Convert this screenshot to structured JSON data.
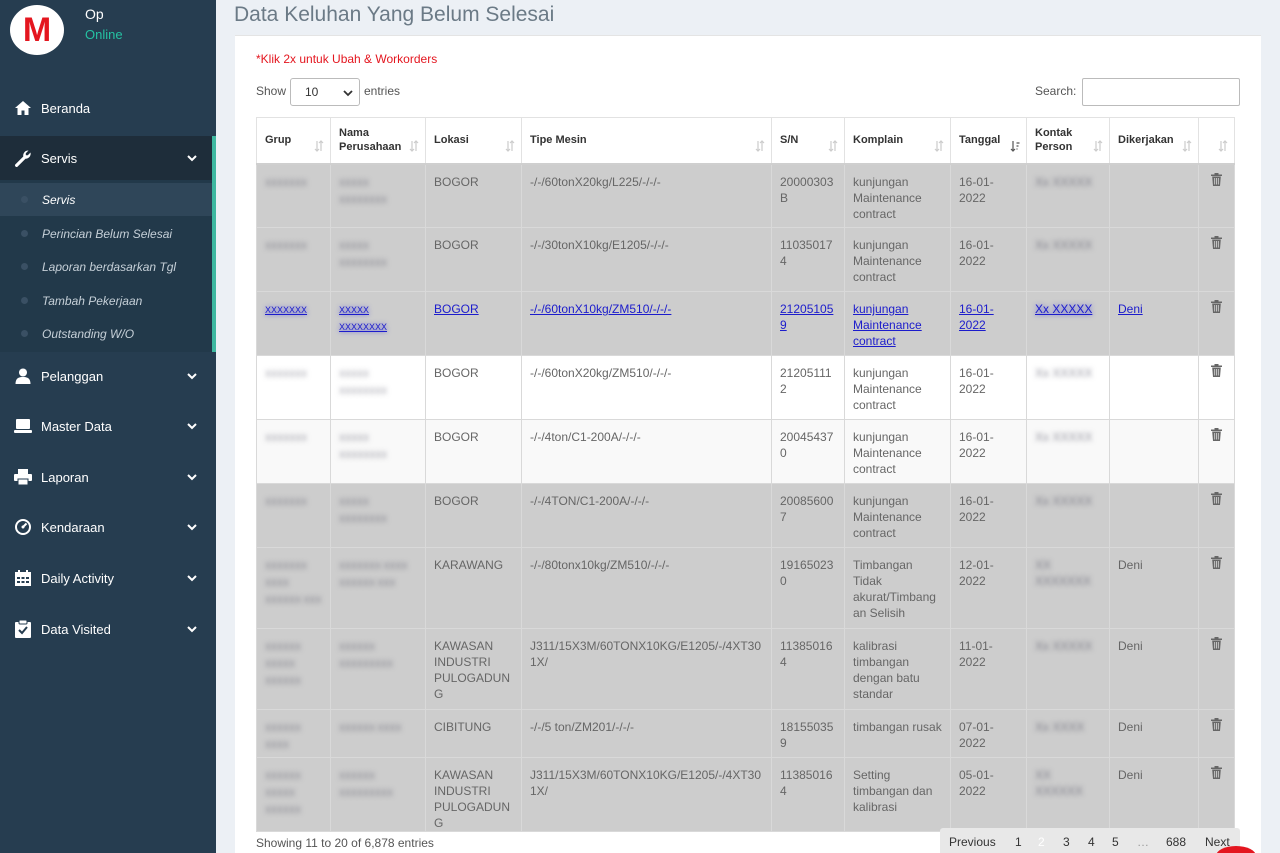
{
  "user": {
    "name": "Op",
    "status": "Online",
    "logo_letter": "M"
  },
  "sidebar": {
    "items": [
      {
        "label": "Beranda",
        "icon": "home-icon"
      },
      {
        "label": "Servis",
        "icon": "wrench-icon"
      },
      {
        "label": "Pelanggan",
        "icon": "user-icon"
      },
      {
        "label": "Master Data",
        "icon": "laptop-icon"
      },
      {
        "label": "Laporan",
        "icon": "printer-icon"
      },
      {
        "label": "Kendaraan",
        "icon": "gauge-icon"
      },
      {
        "label": "Daily Activity",
        "icon": "calendar-icon"
      },
      {
        "label": "Data Visited",
        "icon": "clipboard-icon"
      }
    ],
    "submenu": [
      {
        "label": "Servis"
      },
      {
        "label": "Perincian Belum Selesai"
      },
      {
        "label": "Laporan berdasarkan Tgl"
      },
      {
        "label": "Tambah Pekerjaan"
      },
      {
        "label": "Outstanding W/O"
      }
    ]
  },
  "page": {
    "title": "Data Keluhan Yang Belum Selesai",
    "hint": "*Klik 2x untuk Ubah & Workorders",
    "show_label": "Show",
    "entries_value": "10",
    "entries_label": "entries",
    "search_label": "Search:"
  },
  "table": {
    "headers": [
      "Grup",
      "Nama Perusahaan",
      "Lokasi",
      "Tipe Mesin",
      "S/N",
      "Komplain",
      "Tanggal",
      "Kontak Person",
      "Dikerjakan",
      ""
    ],
    "rows": [
      {
        "style": "grey",
        "grup": "XXXXXXX",
        "nama": "XXXXX XXXXXXXX",
        "lokasi": "BOGOR",
        "tipe": "-/-/60tonX20kg/L225/-/-/-",
        "sn": "20000303B",
        "komplain": "kunjungan Maintenance contract",
        "tanggal": "16-01-2022",
        "kontak": "Xx XXXXX",
        "dikerjakan": ""
      },
      {
        "style": "grey",
        "grup": "XXXXXXX",
        "nama": "XXXXX XXXXXXXX",
        "lokasi": "BOGOR",
        "tipe": "-/-/30tonX10kg/E1205/-/-/-",
        "sn": "110350174",
        "komplain": "kunjungan Maintenance contract",
        "tanggal": "16-01-2022",
        "kontak": "Xx XXXXX",
        "dikerjakan": ""
      },
      {
        "style": "sel",
        "grup": "XXXXXXX",
        "nama": "XXXXX XXXXXXXX",
        "lokasi": "BOGOR",
        "tipe": "-/-/60tonX10kg/ZM510/-/-/-",
        "sn": "212051059",
        "komplain": "kunjungan Maintenance contract",
        "tanggal": "16-01-2022",
        "kontak": "Xx XXXXX",
        "dikerjakan": "Deni"
      },
      {
        "style": "white",
        "grup": "XXXXXXX",
        "nama": "XXXXX XXXXXXXX",
        "lokasi": "BOGOR",
        "tipe": "-/-/60tonX20kg/ZM510/-/-/-",
        "sn": "212051112",
        "komplain": "kunjungan Maintenance contract",
        "tanggal": "16-01-2022",
        "kontak": "Xx XXXXX",
        "dikerjakan": ""
      },
      {
        "style": "light",
        "grup": "XXXXXXX",
        "nama": "XXXXX XXXXXXXX",
        "lokasi": "BOGOR",
        "tipe": "-/-/4ton/C1-200A/-/-/-",
        "sn": "200454370",
        "komplain": "kunjungan Maintenance contract",
        "tanggal": "16-01-2022",
        "kontak": "Xx XXXXX",
        "dikerjakan": ""
      },
      {
        "style": "grey",
        "grup": "XXXXXXX",
        "nama": "XXXXX XXXXXXXX",
        "lokasi": "BOGOR",
        "tipe": "-/-/4TON/C1-200A/-/-/-",
        "sn": "200856007",
        "komplain": "kunjungan Maintenance contract",
        "tanggal": "16-01-2022",
        "kontak": "Xx XXXXX",
        "dikerjakan": ""
      },
      {
        "style": "grey",
        "grup": "XXXXXXX XXXX XXXXXX XXX",
        "nama": "XXXXXXX XXXX XXXXXX XXX",
        "lokasi": "KARAWANG",
        "tipe": "-/-/80tonx10kg/ZM510/-/-/-",
        "sn": "191650230",
        "komplain": "Timbangan Tidak akurat/Timbangan Selisih",
        "tanggal": "12-01-2022",
        "kontak": "XX XXXXXXX",
        "dikerjakan": "Deni"
      },
      {
        "style": "grey",
        "grup": "XXXXXX XXXXX XXXXXX",
        "nama": "XXXXXX XXXXXXXXX",
        "lokasi": "KAWASAN INDUSTRI PULOGADUNG",
        "tipe": "J311/15X3M/60TONX10KG/E1205/-/4XT301X/",
        "sn": "113850164",
        "komplain": "kalibrasi timbangan dengan batu standar",
        "tanggal": "11-01-2022",
        "kontak": "Xx XXXXX",
        "dikerjakan": "Deni"
      },
      {
        "style": "grey",
        "grup": "XXXXXX XXXX",
        "nama": "XXXXXX XXXX",
        "lokasi": "CIBITUNG",
        "tipe": "-/-/5 ton/ZM201/-/-/-",
        "sn": "181550359",
        "komplain": "timbangan rusak",
        "tanggal": "07-01-2022",
        "kontak": "Xx XXXX",
        "dikerjakan": "Deni"
      },
      {
        "style": "grey",
        "grup": "XXXXXX XXXXX XXXXXX",
        "nama": "XXXXXX XXXXXXXXX",
        "lokasi": "KAWASAN INDUSTRI PULOGADUNG",
        "tipe": "J311/15X3M/60TONX10KG/E1205/-/4XT301X/",
        "sn": "113850164",
        "komplain": "Setting timbangan dan kalibrasi",
        "tanggal": "05-01-2022",
        "kontak": "XX XXXXXX",
        "dikerjakan": "Deni"
      }
    ]
  },
  "footer": {
    "info": "Showing 11 to 20 of 6,878 entries",
    "pager": [
      "Previous",
      "1",
      "2",
      "3",
      "4",
      "5",
      "…",
      "688",
      "Next"
    ]
  },
  "colors": {
    "sidebar": "#263d50",
    "accent": "#3eb8a0",
    "hint": "#e4161f",
    "online": "#25c1a2"
  }
}
